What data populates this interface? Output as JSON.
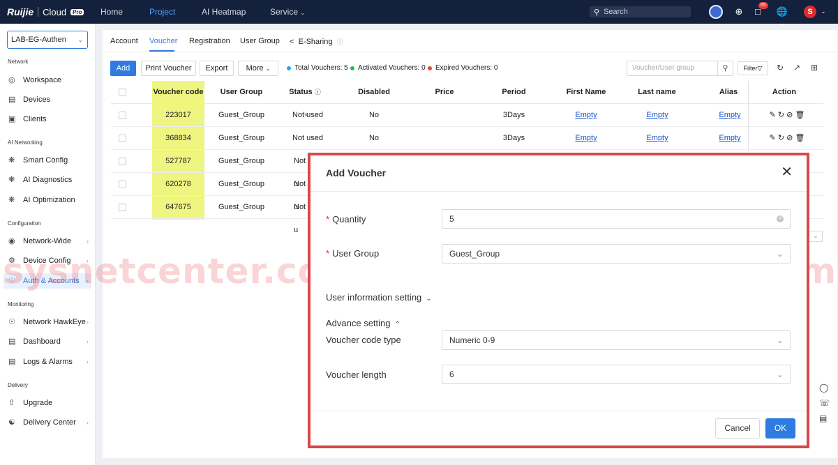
{
  "topbar": {
    "brand": "Ruijie",
    "product": "Cloud",
    "edition": "Pro",
    "nav": [
      "Home",
      "Project",
      "AI Heatmap",
      "Service"
    ],
    "active_nav": "Project",
    "search_placeholder": "Search",
    "notification_count": "65",
    "user_initial": "S"
  },
  "sidebar": {
    "project": "LAB-EG-Authen",
    "sections": [
      {
        "title": "Network",
        "items": [
          "Workspace",
          "Devices",
          "Clients"
        ]
      },
      {
        "title": "AI Networking",
        "items": [
          "Smart Config",
          "AI Diagnostics",
          "AI Optimization"
        ]
      },
      {
        "title": "Configuration",
        "items": [
          "Network-Wide",
          "Device Config",
          "Auth & Accounts"
        ]
      },
      {
        "title": "Monitoring",
        "items": [
          "Network HawkEye",
          "Dashboard",
          "Logs & Alarms"
        ]
      },
      {
        "title": "Delivery",
        "items": [
          "Upgrade",
          "Delivery Center"
        ]
      }
    ],
    "active_item": "Auth & Accounts"
  },
  "tabs": [
    "Account",
    "Voucher",
    "Registration",
    "User Group",
    "E-Sharing"
  ],
  "active_tab": "Voucher",
  "toolbar": {
    "add": "Add",
    "print": "Print Voucher",
    "export": "Export",
    "more": "More",
    "stats": {
      "total": "Total Vouchers: 5",
      "activated": "Activated Vouchers: 0",
      "expired": "Expired Vouchers: 0"
    },
    "search_placeholder": "Voucher/User group",
    "filter": "Filter"
  },
  "table": {
    "headers": [
      "Voucher code",
      "User Group",
      "Status",
      "Disabled",
      "Price",
      "Period",
      "First Name",
      "Last name",
      "Alias",
      "Action"
    ],
    "rows": [
      {
        "code": "223017",
        "group": "Guest_Group",
        "status": "Not used",
        "disabled": "No",
        "period": "3Days",
        "first": "Empty",
        "last": "Empty",
        "alias": "Empty"
      },
      {
        "code": "368834",
        "group": "Guest_Group",
        "status": "Not used",
        "disabled": "No",
        "period": "3Days",
        "first": "Empty",
        "last": "Empty",
        "alias": "Empty"
      },
      {
        "code": "527787",
        "group": "Guest_Group",
        "status": "Not u"
      },
      {
        "code": "620278",
        "group": "Guest_Group",
        "status": "Not u"
      },
      {
        "code": "647675",
        "group": "Guest_Group",
        "status": "Not u"
      }
    ]
  },
  "watermark": "sysnetcenter.com",
  "modal": {
    "title": "Add Voucher",
    "quantity_label": "Quantity",
    "quantity_value": "5",
    "user_group_label": "User Group",
    "user_group_value": "Guest_Group",
    "user_info_label": "User information setting",
    "advance_label": "Advance setting",
    "code_type_label": "Voucher code type",
    "code_type_value": "Numeric 0-9",
    "length_label": "Voucher length",
    "length_value": "6",
    "cancel": "Cancel",
    "ok": "OK"
  },
  "colors": {
    "accent": "#2f7be0",
    "highlight": "#eef580",
    "frame": "#d94848",
    "nav_bg": "#14213d"
  }
}
